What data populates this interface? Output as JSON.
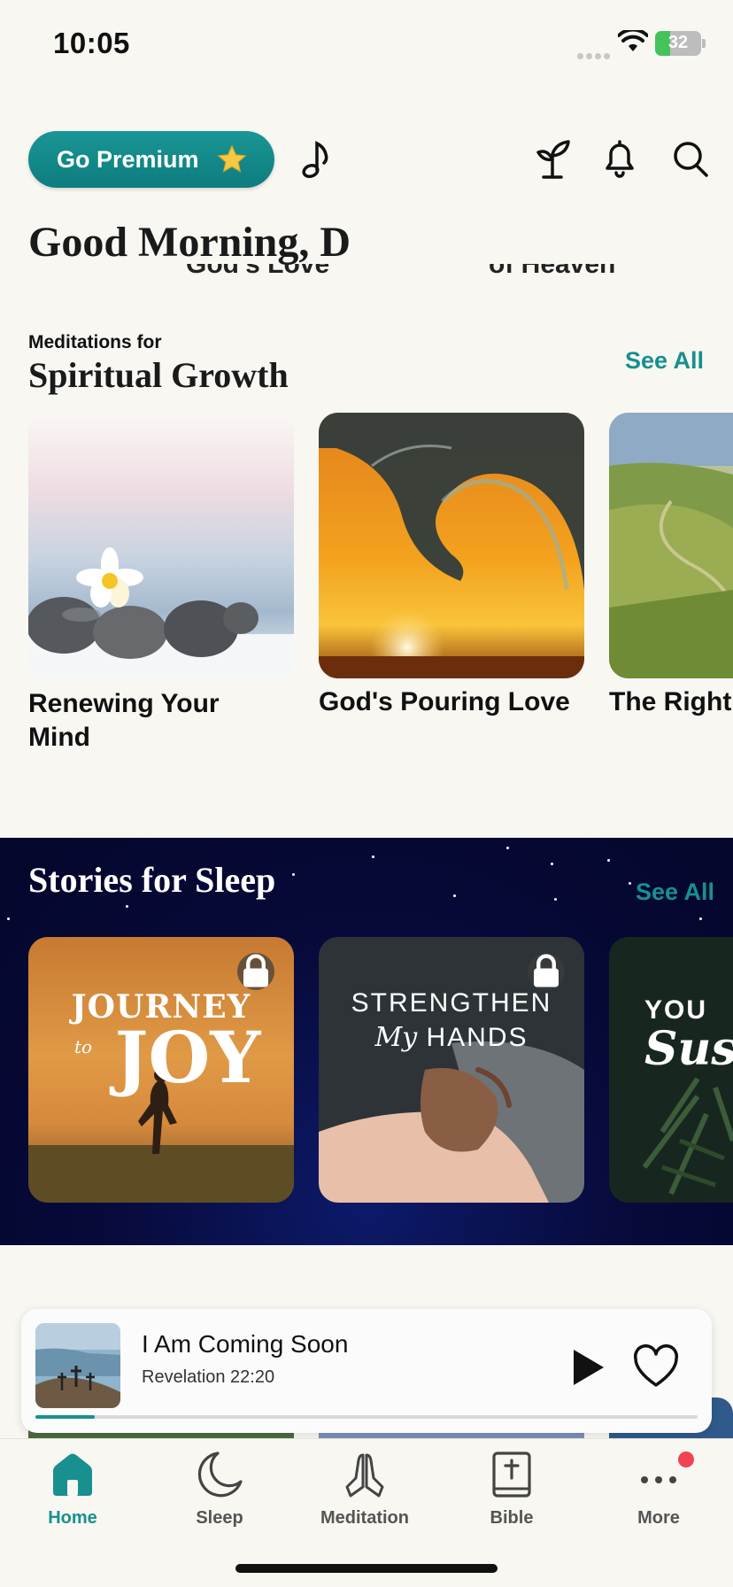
{
  "status_bar": {
    "time": "10:05",
    "battery": "32",
    "battery_percent": 32
  },
  "header": {
    "premium_label": "Go Premium",
    "greeting": "Good Morning, D"
  },
  "ghost_row": {
    "left": "God's Love",
    "right": "of Heaven"
  },
  "spiritual": {
    "kicker": "Meditations for",
    "title": "Spiritual Growth",
    "see_all": "See All",
    "cards": [
      {
        "title": "Renewing Your Mind"
      },
      {
        "title": "God's Pouring Love"
      },
      {
        "title": "The Right"
      }
    ]
  },
  "sleep": {
    "title": "Stories for Sleep",
    "see_all": "See All",
    "cards": [
      {
        "line1": "JOURNEY",
        "line2_small": "to",
        "line2": "JOY"
      },
      {
        "line1": "STRENGTHEN",
        "line2_small": "My",
        "line2": "HANDS"
      },
      {
        "line1": "YOU",
        "line2": "Sus"
      }
    ]
  },
  "player": {
    "title": "I Am Coming Soon",
    "subtitle": "Revelation 22:20",
    "progress": 0.09
  },
  "tabs": [
    {
      "label": "Home",
      "active": true
    },
    {
      "label": "Sleep"
    },
    {
      "label": "Meditation"
    },
    {
      "label": "Bible"
    },
    {
      "label": "More"
    }
  ],
  "colors": {
    "accent": "#17908f",
    "badge": "#f04452",
    "night": "#070a3a"
  },
  "icons": [
    "star-icon",
    "music-note-icon",
    "sprout-icon",
    "bell-icon",
    "search-icon",
    "lock-icon",
    "play-icon",
    "heart-icon",
    "home-icon",
    "moon-icon",
    "praying-hands-icon",
    "bible-icon",
    "more-icon"
  ]
}
